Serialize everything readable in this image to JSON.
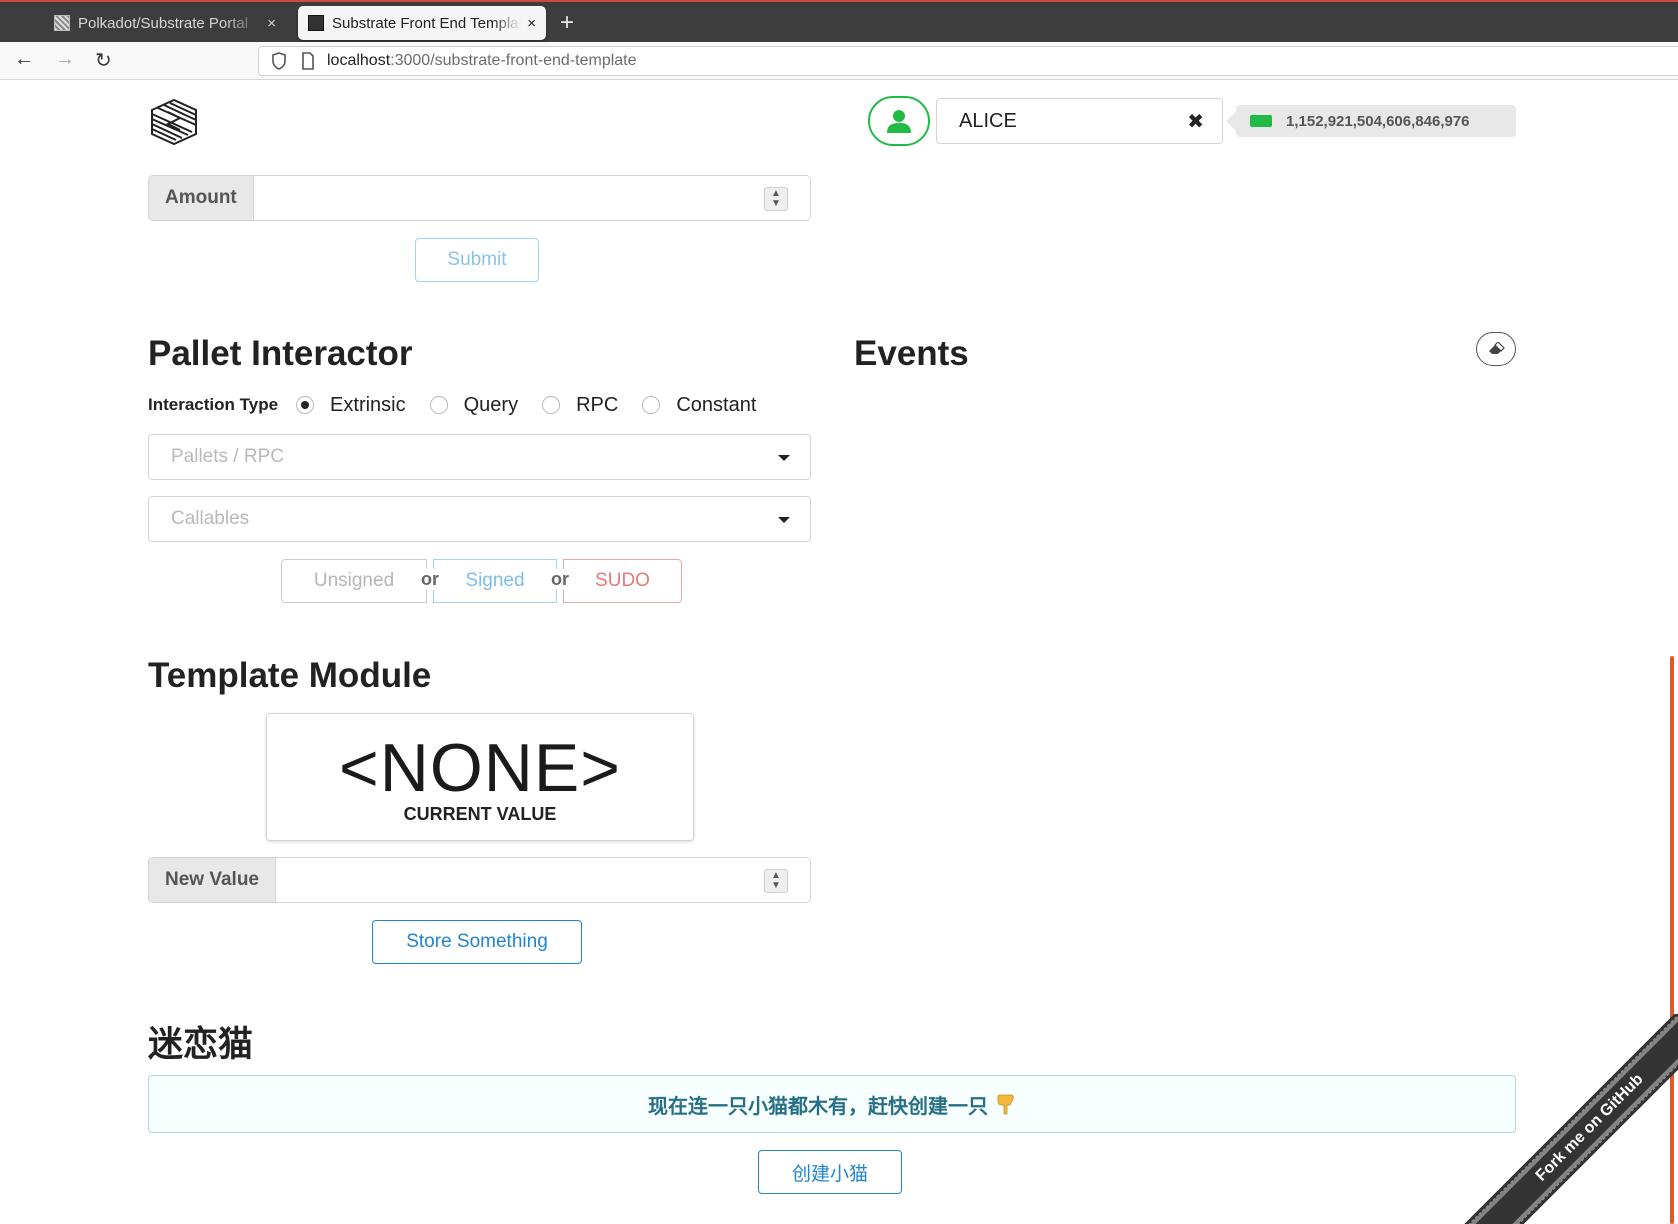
{
  "browser": {
    "tabs": [
      {
        "title": "Polkadot/Substrate Portal",
        "close": "×"
      },
      {
        "title": "Substrate Front End Template",
        "close": "×"
      }
    ],
    "new_tab": "+",
    "url_host": "localhost",
    "url_path": ":3000/substrate-front-end-template"
  },
  "header": {
    "account_name": "ALICE",
    "account_clear": "✖",
    "balance": "1,152,921,504,606,846,976"
  },
  "transfer": {
    "amount_label": "Amount",
    "amount_value": "",
    "submit_label": "Submit"
  },
  "pallet_interactor": {
    "title": "Pallet Interactor",
    "interaction_type_label": "Interaction Type",
    "options": [
      "Extrinsic",
      "Query",
      "RPC",
      "Constant"
    ],
    "selected": "Extrinsic",
    "pallets_placeholder": "Pallets / RPC",
    "callables_placeholder": "Callables",
    "unsigned_label": "Unsigned",
    "or_label": "or",
    "signed_label": "Signed",
    "sudo_label": "SUDO"
  },
  "events": {
    "title": "Events"
  },
  "template_module": {
    "title": "Template Module",
    "current_value": "<NONE>",
    "current_value_label": "CURRENT VALUE",
    "new_value_label": "New Value",
    "new_value": "",
    "store_label": "Store Something"
  },
  "kitties": {
    "title": "迷恋猫",
    "empty_message": "现在连一只小猫都木有，赶快创建一只",
    "empty_icon": "pointing-down-emoji",
    "create_label": "创建小猫"
  },
  "ribbon": {
    "text": "Fork me on GitHub"
  },
  "colors": {
    "green": "#21ba45",
    "blue": "#2185d0",
    "red": "#db2828",
    "info_text": "#276f86"
  }
}
